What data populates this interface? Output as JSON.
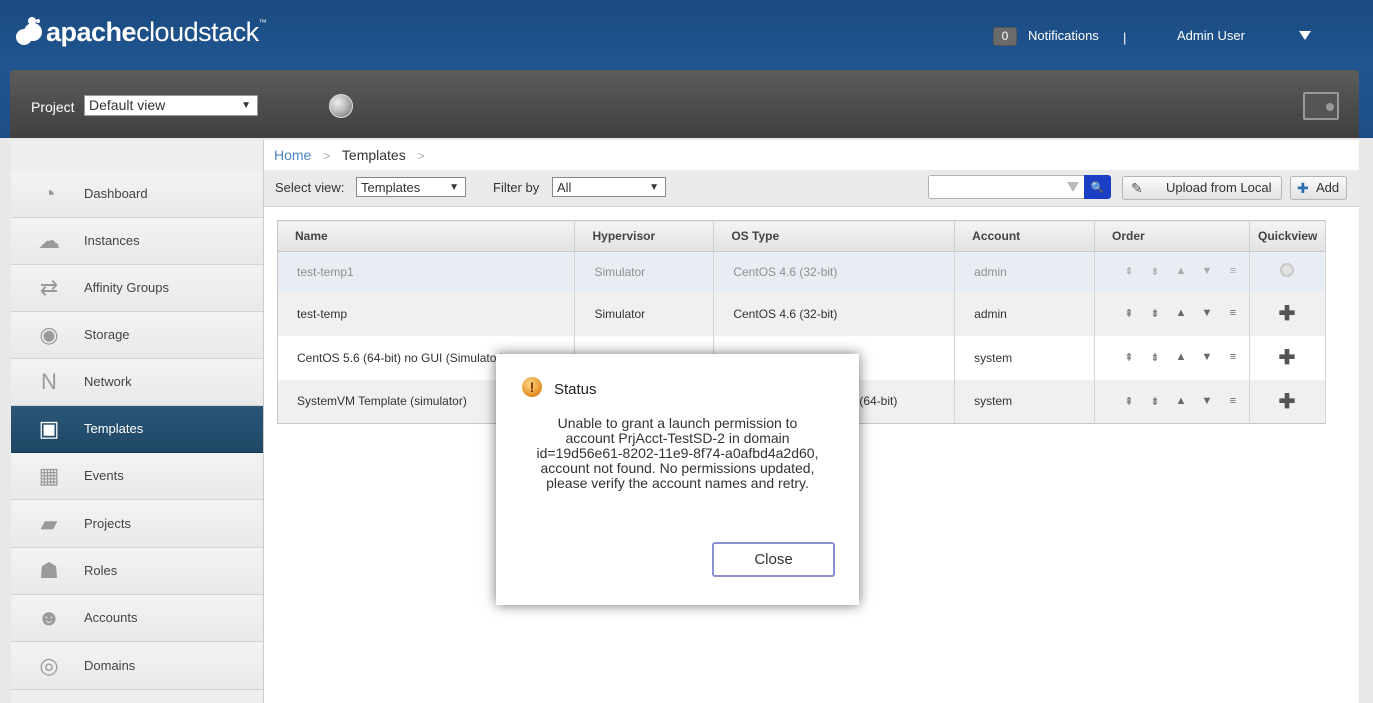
{
  "header": {
    "logo_text_bold": "apache",
    "logo_text_light": "cloudstack",
    "logo_tm": "™",
    "notification_count": "0",
    "notifications_label": "Notifications",
    "separator": "|",
    "user_label": "Admin User"
  },
  "projectbar": {
    "project_label": "Project",
    "project_value": "Default view",
    "select_arrow": "▼"
  },
  "sidebar": {
    "items": [
      {
        "label": "Dashboard",
        "icon": "dashboard-icon",
        "glyph": "◔"
      },
      {
        "label": "Instances",
        "icon": "cloud-icon",
        "glyph": "☁"
      },
      {
        "label": "Affinity Groups",
        "icon": "affinity-cloud-icon",
        "glyph": "⇄"
      },
      {
        "label": "Storage",
        "icon": "disk-icon",
        "glyph": "◉"
      },
      {
        "label": "Network",
        "icon": "network-icon",
        "glyph": "N"
      },
      {
        "label": "Templates",
        "icon": "templates-icon",
        "glyph": "▣"
      },
      {
        "label": "Events",
        "icon": "calendar-icon",
        "glyph": "▦"
      },
      {
        "label": "Projects",
        "icon": "folder-icon",
        "glyph": "▰"
      },
      {
        "label": "Roles",
        "icon": "roles-icon",
        "glyph": "☗"
      },
      {
        "label": "Accounts",
        "icon": "user-icon",
        "glyph": "☻"
      },
      {
        "label": "Domains",
        "icon": "domains-icon",
        "glyph": "◎"
      }
    ],
    "active_index": 5
  },
  "breadcrumb": {
    "home": "Home",
    "sep1": ">",
    "current": "Templates",
    "sep2": ">"
  },
  "toolbar": {
    "select_view_label": "Select view:",
    "select_view_value": "Templates",
    "filter_label": "Filter by",
    "filter_value": "All",
    "arrow": "▼",
    "search_button_glyph": "🔍",
    "upload_label": "Upload from Local",
    "add_label": "Add",
    "add_glyph": "✚",
    "upload_glyph": "✎"
  },
  "table": {
    "columns": [
      "Name",
      "Hypervisor",
      "OS Type",
      "Account",
      "Order",
      "Quickview"
    ],
    "rows": [
      {
        "name": "test-temp1",
        "hypervisor": "Simulator",
        "os": "CentOS 4.6 (32-bit)",
        "account": "admin"
      },
      {
        "name": "test-temp",
        "hypervisor": "Simulator",
        "os": "CentOS 4.6 (32-bit)",
        "account": "admin"
      },
      {
        "name": "CentOS 5.6 (64-bit) no GUI (Simulator)",
        "hypervisor": "",
        "os": "",
        "account": "system"
      },
      {
        "name": "SystemVM Template (simulator)",
        "hypervisor": "",
        "os": "(64-bit)",
        "account": "system"
      }
    ],
    "order_glyphs": [
      "⇞",
      "⇟",
      "▲",
      "▼",
      "≡"
    ],
    "quickview_glyph": "✚"
  },
  "dialog": {
    "title": "Status",
    "warn_glyph": "!",
    "message_lines": [
      "Unable to grant a launch permission to",
      "account PrjAcct-TestSD-2 in domain",
      "id=19d56e61-8202-11e9-8f74-a0afbd4a2d60,",
      "account not found. No permissions updated,",
      "please verify the account names and retry."
    ],
    "close_label": "Close"
  },
  "colors": {
    "header_blue": "#1f5590",
    "active_nav": "#2a5677",
    "search_button": "#1a3fc4",
    "link_blue": "#4a86c5"
  }
}
